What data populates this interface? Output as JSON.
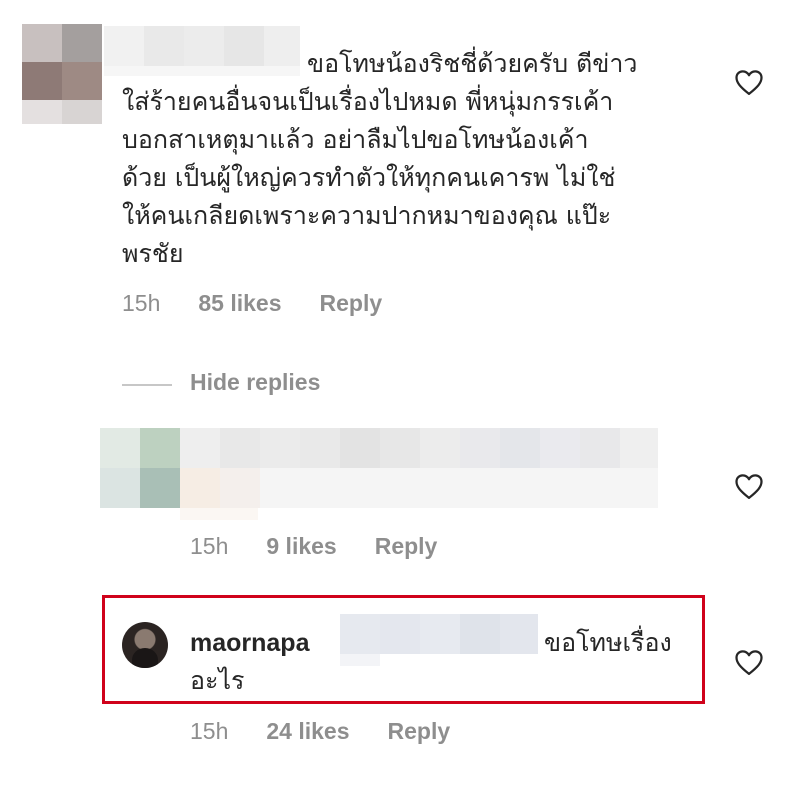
{
  "comment": {
    "text_line1": "ขอโทษน้องริชชี่ด้วยครับ ตีข่าว",
    "text_lines": [
      "ใส่ร้ายคนอื่นจนเป็นเรื่องไปหมด พี่หนุ่มกรรเค้า",
      "บอกสาเหตุมาแล้ว อย่าลืมไปขอโทษน้องเค้า",
      "ด้วย เป็นผู้ใหญ่ควรทำตัวให้ทุกคนเคารพ ไม่ใช่",
      "ให้คนเกลียดเพราะความปากหมาของคุณ แป๊ะ",
      "พรชัย"
    ],
    "time": "15h",
    "likes": "85 likes",
    "reply": "Reply",
    "like_icon": "heart-outline-icon"
  },
  "thread": {
    "hide_replies": "Hide replies"
  },
  "reply1": {
    "time": "15h",
    "likes": "9 likes",
    "reply": "Reply",
    "like_icon": "heart-outline-icon"
  },
  "reply2": {
    "username": "maornapa",
    "text_line1": "ขอโทษเรื่อง",
    "text_line2": "อะไร",
    "time": "15h",
    "likes": "24 likes",
    "reply": "Reply",
    "like_icon": "heart-outline-icon",
    "highlight_color": "#d0021b"
  }
}
